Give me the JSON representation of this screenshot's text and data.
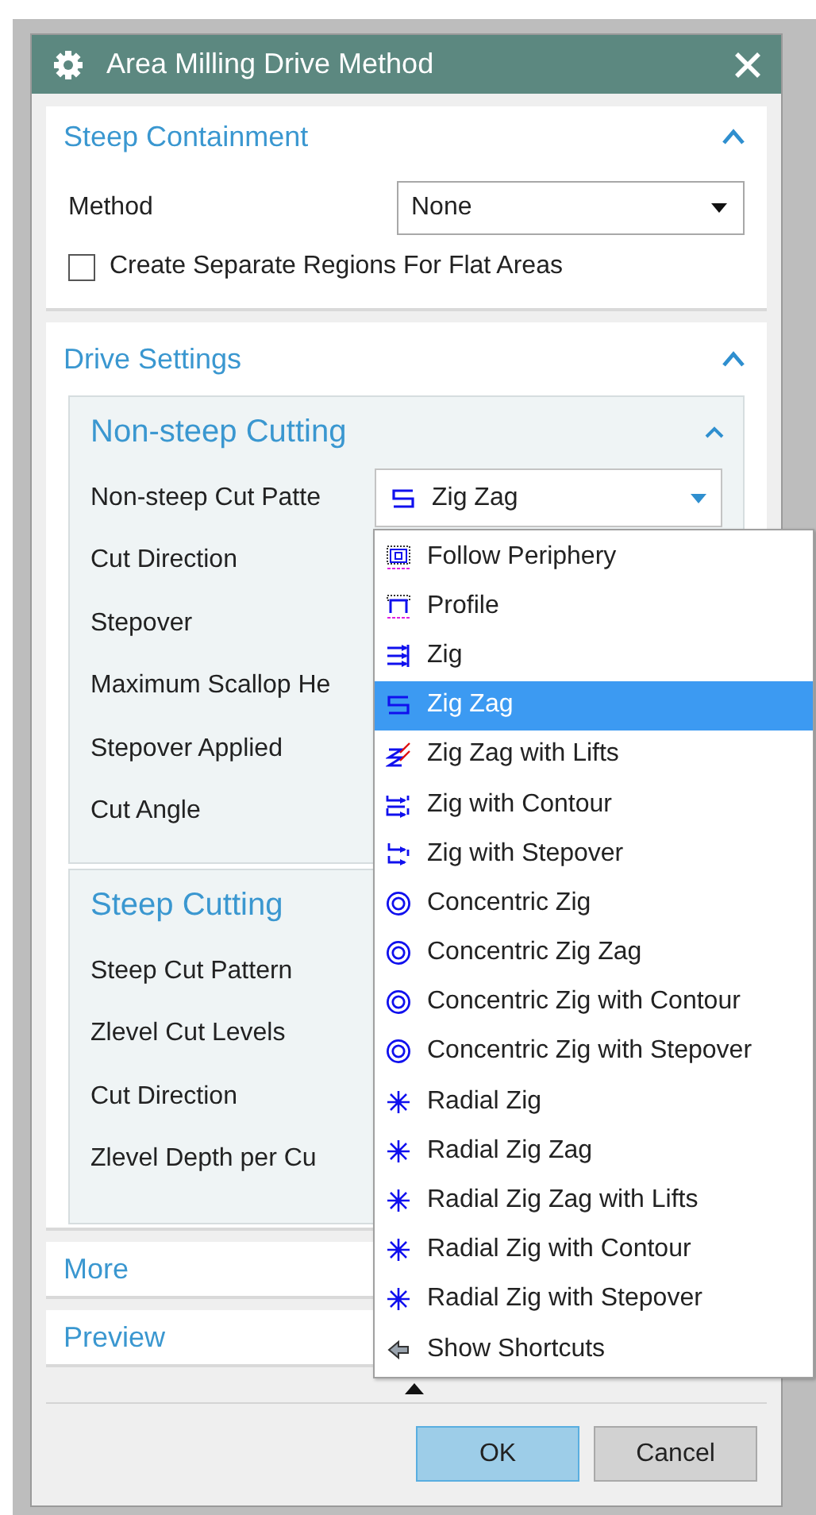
{
  "window": {
    "title": "Area Milling Drive Method"
  },
  "steep_containment": {
    "title": "Steep Containment",
    "method_label": "Method",
    "method_value": "None",
    "checkbox": {
      "label": "Create Separate Regions For Flat Areas",
      "checked": false
    }
  },
  "drive_settings": {
    "title": "Drive Settings",
    "groups": [
      {
        "title": "Non-steep Cutting",
        "rows": [
          {
            "label": "Non-steep Cut Patte",
            "kind": "combo",
            "value": "Zig Zag"
          },
          {
            "label": "Cut Direction",
            "kind": "label"
          },
          {
            "label": "Stepover",
            "kind": "label"
          },
          {
            "label": "Maximum Scallop He",
            "kind": "label"
          },
          {
            "label": "Stepover Applied",
            "kind": "label"
          },
          {
            "label": "Cut Angle",
            "kind": "label"
          }
        ]
      },
      {
        "title": "Steep Cutting",
        "rows": [
          {
            "label": "Steep Cut Pattern",
            "kind": "label"
          },
          {
            "label": "Zlevel Cut Levels",
            "kind": "label"
          },
          {
            "label": "Cut Direction",
            "kind": "label"
          },
          {
            "label": "Zlevel Depth per Cu",
            "kind": "label"
          }
        ]
      }
    ]
  },
  "collapsed_sections": [
    "More",
    "Preview"
  ],
  "dropdown": {
    "items": [
      {
        "label": "Follow Periphery",
        "kind": "periphery",
        "selected": false
      },
      {
        "label": "Profile",
        "kind": "profile",
        "selected": false
      },
      {
        "label": "Zig",
        "kind": "zig",
        "selected": false
      },
      {
        "label": "Zig Zag",
        "kind": "zigzag",
        "selected": true
      },
      {
        "label": "Zig Zag with Lifts",
        "kind": "lifts",
        "selected": false
      },
      {
        "label": "Zig with Contour",
        "kind": "contour",
        "selected": false
      },
      {
        "label": "Zig with Stepover",
        "kind": "stepover",
        "selected": false
      },
      {
        "label": "Concentric Zig",
        "kind": "concentric",
        "selected": false
      },
      {
        "label": "Concentric Zig Zag",
        "kind": "concentric",
        "selected": false
      },
      {
        "label": "Concentric Zig with Contour",
        "kind": "concentric",
        "selected": false
      },
      {
        "label": "Concentric Zig with Stepover",
        "kind": "concentric",
        "selected": false
      },
      {
        "label": "Radial Zig",
        "kind": "radial",
        "selected": false
      },
      {
        "label": "Radial Zig Zag",
        "kind": "radial",
        "selected": false
      },
      {
        "label": "Radial Zig Zag with Lifts",
        "kind": "radial",
        "selected": false
      },
      {
        "label": "Radial Zig with Contour",
        "kind": "radial",
        "selected": false
      },
      {
        "label": "Radial Zig with Stepover",
        "kind": "radial",
        "selected": false
      },
      {
        "label": "Show Shortcuts",
        "kind": "shortcuts",
        "selected": false
      }
    ]
  },
  "buttons": [
    {
      "label": "OK",
      "kind": "primary"
    },
    {
      "label": "Cancel",
      "kind": "secondary"
    }
  ]
}
